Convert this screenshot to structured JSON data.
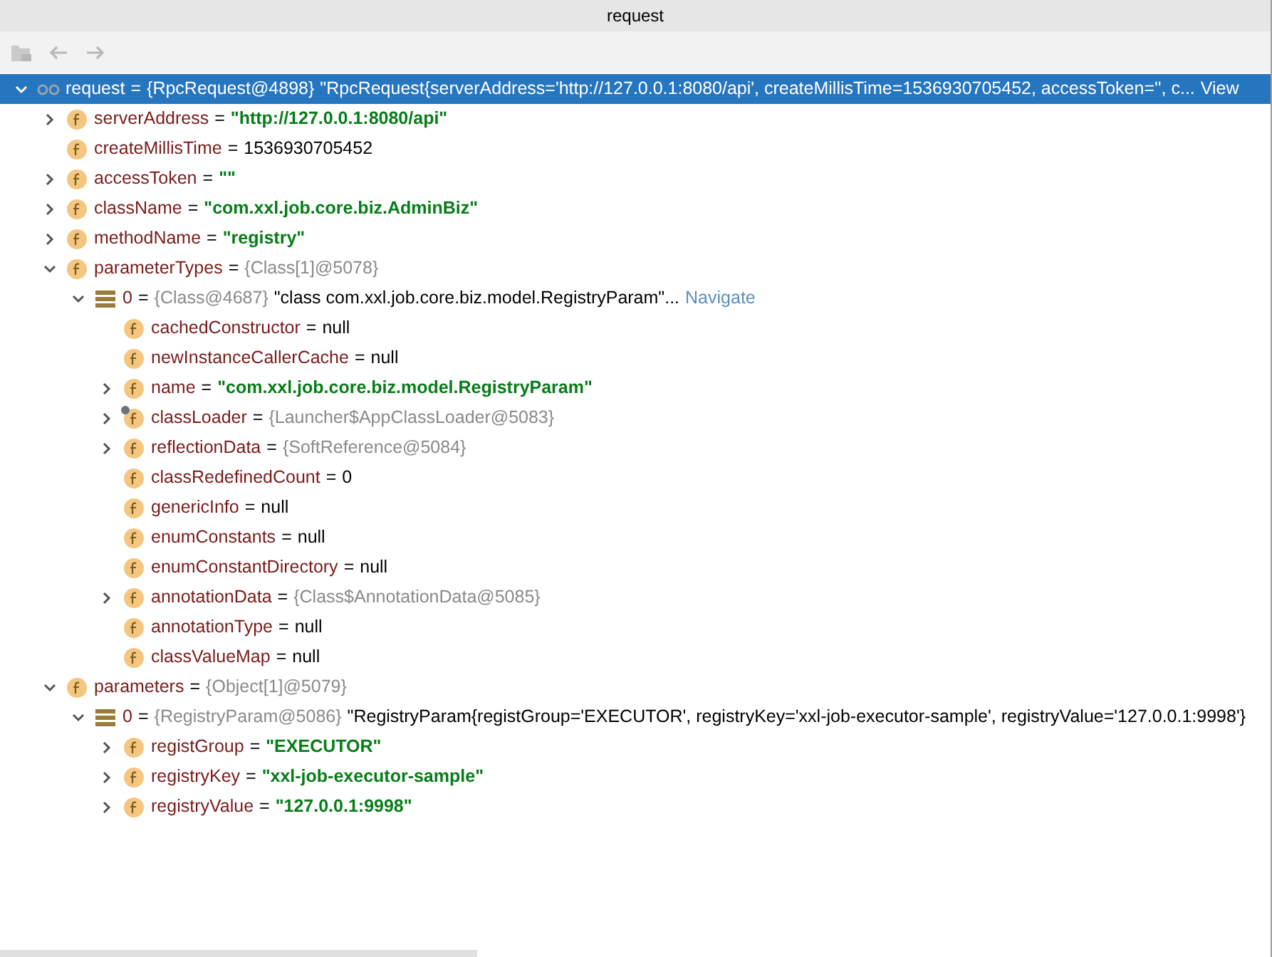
{
  "window": {
    "title": "request"
  },
  "toolbar": {
    "buttons": [
      {
        "kind": "frames",
        "disabled": true
      },
      {
        "kind": "back",
        "disabled": true
      },
      {
        "kind": "forward",
        "disabled": true
      }
    ]
  },
  "tree": [
    {
      "kind": "watch",
      "name": "request",
      "operator": "=",
      "ref": "{RpcRequest@4898}",
      "value": "\"RpcRequest{serverAddress='http://127.0.0.1:8080/api', createMillisTime=1536930705452, accessToken='', c...",
      "link": "View",
      "expanded": true,
      "selected": true,
      "children": [
        {
          "kind": "field",
          "name": "serverAddress",
          "operator": "=",
          "string_value": "\"http://127.0.0.1:8080/api\"",
          "expanded": false,
          "selected": false
        },
        {
          "kind": "field",
          "name": "createMillisTime",
          "operator": "=",
          "value": "1536930705452",
          "selected": false
        },
        {
          "kind": "field",
          "name": "accessToken",
          "operator": "=",
          "string_value": "\"\"",
          "expanded": false,
          "selected": false
        },
        {
          "kind": "field",
          "name": "className",
          "operator": "=",
          "string_value": "\"com.xxl.job.core.biz.AdminBiz\"",
          "expanded": false,
          "selected": false
        },
        {
          "kind": "field",
          "name": "methodName",
          "operator": "=",
          "string_value": "\"registry\"",
          "expanded": false,
          "selected": false
        },
        {
          "kind": "field",
          "name": "parameterTypes",
          "operator": "=",
          "ref": "{Class[1]@5078}",
          "expanded": true,
          "selected": false,
          "children": [
            {
              "kind": "array",
              "name": "0",
              "operator": "=",
              "ref": "{Class@4687}",
              "value": "\"class com.xxl.job.core.biz.model.RegistryParam\"...",
              "link": "Navigate",
              "expanded": true,
              "selected": false,
              "children": [
                {
                  "kind": "field",
                  "name": "cachedConstructor",
                  "operator": "=",
                  "value": "null",
                  "selected": false
                },
                {
                  "kind": "field",
                  "name": "newInstanceCallerCache",
                  "operator": "=",
                  "value": "null",
                  "selected": false
                },
                {
                  "kind": "field",
                  "name": "name",
                  "operator": "=",
                  "string_value": "\"com.xxl.job.core.biz.model.RegistryParam\"",
                  "expanded": false,
                  "selected": false
                },
                {
                  "kind": "pinned",
                  "name": "classLoader",
                  "operator": "=",
                  "ref": "{Launcher$AppClassLoader@5083}",
                  "expanded": false,
                  "selected": false
                },
                {
                  "kind": "field",
                  "name": "reflectionData",
                  "operator": "=",
                  "ref": "{SoftReference@5084}",
                  "expanded": false,
                  "selected": false
                },
                {
                  "kind": "field",
                  "name": "classRedefinedCount",
                  "operator": "=",
                  "value": "0",
                  "selected": false
                },
                {
                  "kind": "field",
                  "name": "genericInfo",
                  "operator": "=",
                  "value": "null",
                  "selected": false
                },
                {
                  "kind": "field",
                  "name": "enumConstants",
                  "operator": "=",
                  "value": "null",
                  "selected": false
                },
                {
                  "kind": "field",
                  "name": "enumConstantDirectory",
                  "operator": "=",
                  "value": "null",
                  "selected": false
                },
                {
                  "kind": "field",
                  "name": "annotationData",
                  "operator": "=",
                  "ref": "{Class$AnnotationData@5085}",
                  "expanded": false,
                  "selected": false
                },
                {
                  "kind": "field",
                  "name": "annotationType",
                  "operator": "=",
                  "value": "null",
                  "selected": false
                },
                {
                  "kind": "field",
                  "name": "classValueMap",
                  "operator": "=",
                  "value": "null",
                  "selected": false
                }
              ]
            }
          ]
        },
        {
          "kind": "field",
          "name": "parameters",
          "operator": "=",
          "ref": "{Object[1]@5079}",
          "expanded": true,
          "selected": false,
          "children": [
            {
              "kind": "array",
              "name": "0",
              "operator": "=",
              "ref": "{RegistryParam@5086}",
              "value": "\"RegistryParam{registGroup='EXECUTOR', registryKey='xxl-job-executor-sample', registryValue='127.0.0.1:9998'}",
              "expanded": true,
              "selected": false,
              "children": [
                {
                  "kind": "field",
                  "name": "registGroup",
                  "operator": "=",
                  "string_value": "\"EXECUTOR\"",
                  "expanded": false,
                  "selected": false
                },
                {
                  "kind": "field",
                  "name": "registryKey",
                  "operator": "=",
                  "string_value": "\"xxl-job-executor-sample\"",
                  "expanded": false,
                  "selected": false
                },
                {
                  "kind": "field",
                  "name": "registryValue",
                  "operator": "=",
                  "string_value": "\"127.0.0.1:9998\"",
                  "expanded": false,
                  "selected": false
                }
              ]
            }
          ]
        }
      ]
    }
  ]
}
